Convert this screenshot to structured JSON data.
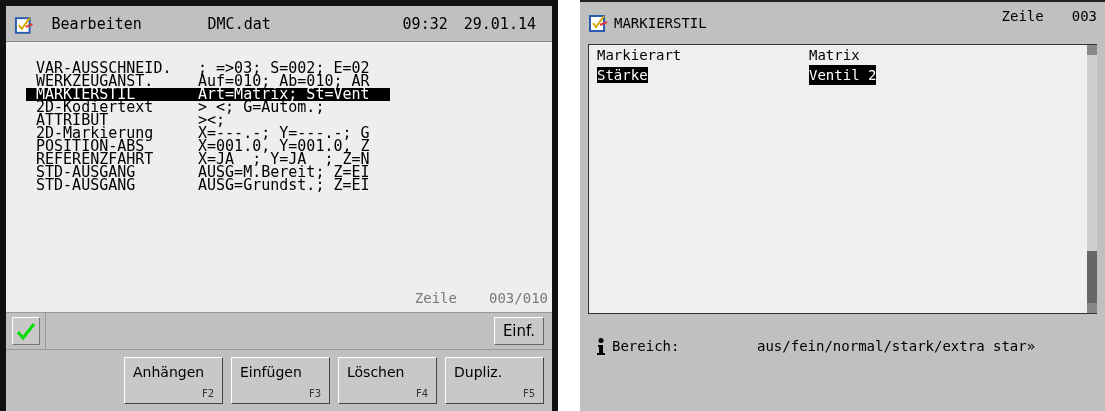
{
  "editor": {
    "title": "Bearbeiten",
    "file": "DMC.dat",
    "time": "09:32",
    "date": "29.01.14",
    "rows": [
      {
        "label": "VAR-AUSSCHNEID.",
        "value": "; =>03; S=002; E=02",
        "selected": false
      },
      {
        "label": "WERKZEUGANST.",
        "value": "Auf=010; Ab=010; AR",
        "selected": false
      },
      {
        "label": "MARKIERSTIL",
        "value": "Art=Matrix; St=Vent",
        "selected": true
      },
      {
        "label": "2D-Kodiertext",
        "value": "> <; G=Autom.;",
        "selected": false
      },
      {
        "label": "ATTRIBUT",
        "value": "><;",
        "selected": false
      },
      {
        "label": "2D-Markierung",
        "value": "X=---.-; Y=---.-; G",
        "selected": false
      },
      {
        "label": "POSITION-ABS",
        "value": "X=001.0, Y=001.0, Z",
        "selected": false
      },
      {
        "label": "REFERENZFAHRT",
        "value": "X=JA  ; Y=JA  ; Z=N",
        "selected": false
      },
      {
        "label": "STD-AUSGANG",
        "value": "AUSG=M.Bereit; Z=EI",
        "selected": false
      },
      {
        "label": "STD-AUSGANG",
        "value": "AUSG=Grundst.; Z=EI",
        "selected": false
      }
    ],
    "line_label": "Zeile",
    "line_value": "003/010",
    "insert_button": "Einf.",
    "function_keys": [
      {
        "label": "Anhängen",
        "key": "F2"
      },
      {
        "label": "Einfügen",
        "key": "F3"
      },
      {
        "label": "Löschen",
        "key": "F4"
      },
      {
        "label": "Dupliz.",
        "key": "F5"
      }
    ]
  },
  "detail": {
    "title": "MARKIERSTIL",
    "line_label": "Zeile",
    "line_value": "003",
    "rows": [
      {
        "label": "Markierart",
        "value": "Matrix",
        "selected": false
      },
      {
        "label": "Stärke",
        "value": "Ventil 2",
        "selected": true
      }
    ],
    "info_label": "Bereich:",
    "info_value": "aus/fein/normal/stark/extra star»"
  }
}
